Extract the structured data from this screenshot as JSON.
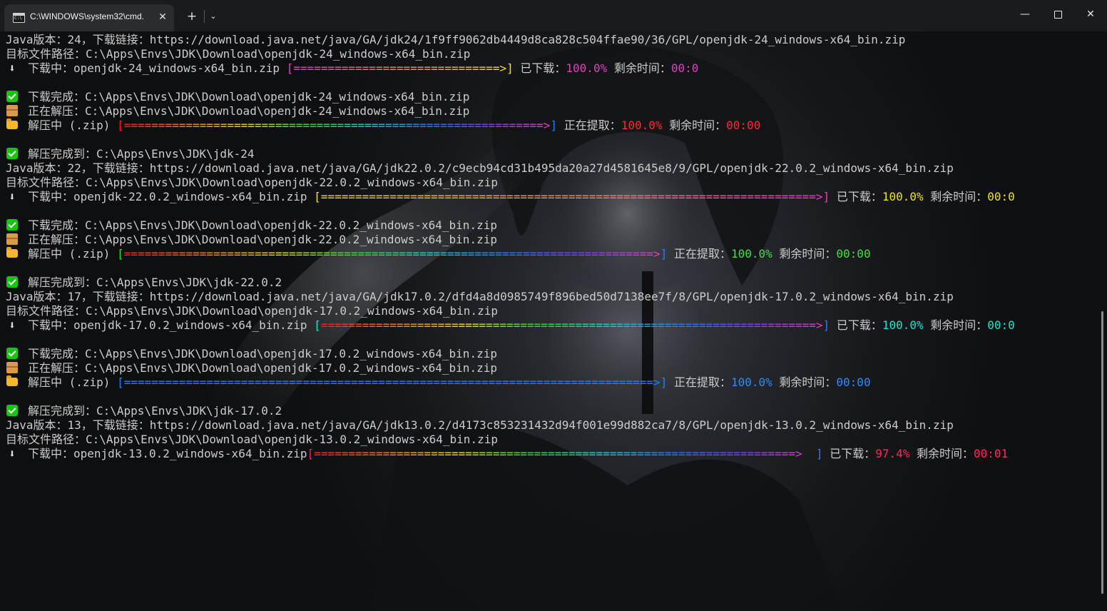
{
  "window": {
    "tab_title": "C:\\WINDOWS\\system32\\cmd.",
    "tab_close": "✕",
    "new_tab": "+",
    "dropdown": "⌄",
    "minimize": "—",
    "close": "✕"
  },
  "terminal": {
    "lines": [
      {
        "text": "Java版本：24，下载链接：https://download.java.net/java/GA/jdk24/1f9ff9062db4449d8ca828c504ffae90/36/GPL/openjdk-24_windows-x64_bin.zip"
      },
      {
        "text": "目标文件路径：C:\\Apps\\Envs\\JDK\\Download\\openjdk-24_windows-x64_bin.zip"
      },
      {
        "icon": "download-arrow-icon",
        "glyph": "⬇",
        "prefix": "下载中：openjdk-24_windows-x64_bin.zip ",
        "bar_open": "[",
        "bar": "==============================>",
        "bar_close": "]",
        "label": " 已下载：",
        "pct": "100.0%",
        "remain": " 剩余时间：",
        "time": "00:0",
        "bar_from": "#e040c0",
        "bar_to": "#f0e020",
        "pct_color": "#e040c0",
        "time_color": "#e040c0"
      },
      {
        "text": ""
      },
      {
        "icon": "check-icon",
        "text": "下载完成：C:\\Apps\\Envs\\JDK\\Download\\openjdk-24_windows-x64_bin.zip"
      },
      {
        "icon": "package-icon",
        "text": "正在解压：C:\\Apps\\Envs\\JDK\\Download\\openjdk-24_windows-x64_bin.zip"
      },
      {
        "icon": "folder-icon",
        "prefix": "解压中 (.zip) ",
        "bar_open": "[",
        "bar": "=============================================================>",
        "bar_close": "]",
        "label": " 正在提取：",
        "pct": "100.0%",
        "remain": " 剩余时间：",
        "time": "00:00",
        "bar_from": "#ff2020",
        "bar_to": "#2080ff",
        "rainbow": true,
        "pct_color": "#ff2a2a",
        "time_color": "#ff2a2a"
      },
      {
        "text": ""
      },
      {
        "icon": "check-icon",
        "text": "解压完成到：C:\\Apps\\Envs\\JDK\\jdk-24"
      },
      {
        "text": "Java版本：22，下载链接：https://download.java.net/java/GA/jdk22.0.2/c9ecb94cd31b495da20a27d4581645e8/9/GPL/openjdk-22.0.2_windows-x64_bin.zip"
      },
      {
        "text": "目标文件路径：C:\\Apps\\Envs\\JDK\\Download\\openjdk-22.0.2_windows-x64_bin.zip"
      },
      {
        "icon": "download-arrow-icon",
        "glyph": "⬇",
        "prefix": "下载中：openjdk-22.0.2_windows-x64_bin.zip ",
        "bar_open": "[",
        "bar": "========================================================================>",
        "bar_close": "]",
        "label": " 已下载：",
        "pct": "100.0%",
        "remain": " 剩余时间：",
        "time": "00:0",
        "bar_from": "#f0e020",
        "bar_to": "#e040c0",
        "pct_color": "#f0e020",
        "time_color": "#f0e020"
      },
      {
        "text": ""
      },
      {
        "icon": "check-icon",
        "text": "下载完成：C:\\Apps\\Envs\\JDK\\Download\\openjdk-22.0.2_windows-x64_bin.zip"
      },
      {
        "icon": "package-icon",
        "text": "正在解压：C:\\Apps\\Envs\\JDK\\Download\\openjdk-22.0.2_windows-x64_bin.zip"
      },
      {
        "icon": "folder-icon",
        "prefix": "解压中 (.zip) ",
        "bar_open": "[",
        "bar": "=============================================================================>",
        "bar_close": "]",
        "label": " 正在提取：",
        "pct": "100.0%",
        "remain": " 剩余时间：",
        "time": "00:00",
        "bar_from": "#30e030",
        "bar_to": "#f0e020",
        "rainbow": true,
        "pct_color": "#40e040",
        "time_color": "#40e040"
      },
      {
        "text": ""
      },
      {
        "icon": "check-icon",
        "text": "解压完成到：C:\\Apps\\Envs\\JDK\\jdk-22.0.2"
      },
      {
        "text": "Java版本：17，下载链接：https://download.java.net/java/GA/jdk17.0.2/dfd4a8d0985749f896bed50d7138ee7f/8/GPL/openjdk-17.0.2_windows-x64_bin.zip"
      },
      {
        "text": "目标文件路径：C:\\Apps\\Envs\\JDK\\Download\\openjdk-17.0.2_windows-x64_bin.zip"
      },
      {
        "icon": "download-arrow-icon",
        "glyph": "⬇",
        "prefix": "下载中：openjdk-17.0.2_windows-x64_bin.zip ",
        "bar_open": "[",
        "bar": "========================================================================>",
        "bar_close": "]",
        "label": " 已下载：",
        "pct": "100.0%",
        "remain": " 剩余时间：",
        "time": "00:0",
        "bar_from": "#20e0d0",
        "bar_to": "#20e0d0",
        "rainbow": true,
        "pct_color": "#20e0d0",
        "time_color": "#20e0d0"
      },
      {
        "text": ""
      },
      {
        "icon": "check-icon",
        "text": "下载完成：C:\\Apps\\Envs\\JDK\\Download\\openjdk-17.0.2_windows-x64_bin.zip"
      },
      {
        "icon": "package-icon",
        "text": "正在解压：C:\\Apps\\Envs\\JDK\\Download\\openjdk-17.0.2_windows-x64_bin.zip"
      },
      {
        "icon": "folder-icon",
        "prefix": "解压中 (.zip) ",
        "bar_open": "[",
        "bar": "=============================================================================>",
        "bar_close": "]",
        "label": " 正在提取：",
        "pct": "100.0%",
        "remain": " 剩余时间：",
        "time": "00:00",
        "bar_from": "#2080ff",
        "bar_to": "#2080ff",
        "pct_color": "#2a8cff",
        "time_color": "#2a8cff"
      },
      {
        "text": ""
      },
      {
        "icon": "check-icon",
        "text": "解压完成到：C:\\Apps\\Envs\\JDK\\jdk-17.0.2"
      },
      {
        "text": "Java版本：13，下载链接：https://download.java.net/java/GA/jdk13.0.2/d4173c853231432d94f001e99d882ca7/8/GPL/openjdk-13.0.2_windows-x64_bin.zip"
      },
      {
        "text": "目标文件路径：C:\\Apps\\Envs\\JDK\\Download\\openjdk-13.0.2_windows-x64_bin.zip"
      },
      {
        "icon": "download-arrow-icon",
        "glyph": "⬇",
        "prefix": "下载中：openjdk-13.0.2_windows-x64_bin.zip",
        "bar_open": "[",
        "bar": "======================================================================>  ",
        "bar_close": "]",
        "label": " 已下载：",
        "pct": "97.4%",
        "pct_suffix": "%",
        "remain": " 剩余时间：",
        "time": "00:01",
        "bar_from": "#ff2060",
        "bar_to": "#2080ff",
        "rainbow": true,
        "pct_color": "#ff2a5a",
        "time_color": "#ff2a5a"
      }
    ]
  }
}
